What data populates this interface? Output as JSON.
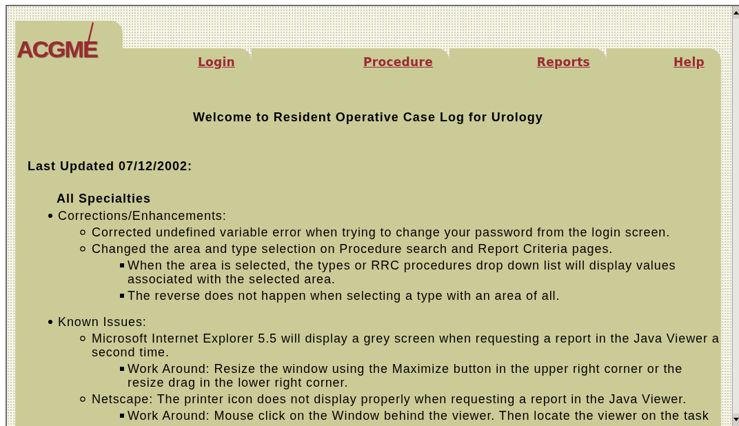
{
  "header": {
    "logo": "ACGME",
    "nav_links": [
      {
        "label": "Login"
      },
      {
        "label": "Procedure"
      },
      {
        "label": "Reports"
      },
      {
        "label": "Help"
      }
    ]
  },
  "title": "Welcome to Resident Operative Case Log for Urology",
  "last_updated": "Last Updated 07/12/2002:",
  "section_heading": "All Specialties",
  "items": [
    {
      "text": "Corrections/Enhancements:",
      "children": [
        {
          "text": "Corrected undefined variable error when trying to change your password from the login screen."
        },
        {
          "text": "Changed the area and type selection on Procedure search and Report Criteria pages.",
          "children": [
            {
              "text": "When the area is selected, the types or RRC procedures drop down list will display values associated with the selected area."
            },
            {
              "text": "The reverse does not happen when selecting a type with an area of all."
            }
          ]
        }
      ]
    },
    {
      "text": "Known Issues:",
      "children": [
        {
          "text": "Microsoft Internet Explorer 5.5 will display a grey screen when requesting a report in the Java Viewer a second time.",
          "children": [
            {
              "text": "Work Around: Resize the window using the Maximize button in the upper right corner or the resize drag in the lower right corner."
            }
          ]
        },
        {
          "text": "Netscape: The printer icon does not display properly when requesting a report in the Java Viewer.",
          "children": [
            {
              "text": "Work Around: Mouse click on the Window behind the viewer. Then locate the viewer on the task"
            }
          ]
        }
      ]
    }
  ]
}
